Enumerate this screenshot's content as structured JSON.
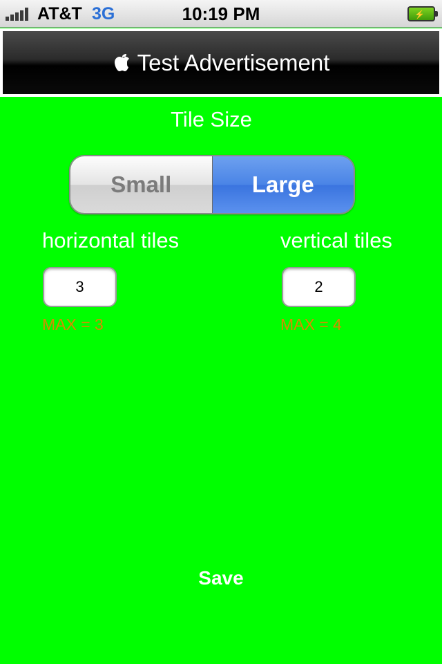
{
  "status_bar": {
    "carrier": "AT&T",
    "network": "3G",
    "time": "10:19 PM",
    "icons": [
      "signal-bars-icon",
      "battery-charging-icon"
    ]
  },
  "ad": {
    "text": "Test Advertisement",
    "icon": "apple-logo-icon"
  },
  "settings": {
    "title": "Tile Size",
    "segments": [
      "Small",
      "Large"
    ],
    "selected_segment": "Large",
    "horizontal": {
      "label": "horizontal tiles",
      "value": "3",
      "max": "MAX = 3"
    },
    "vertical": {
      "label": "vertical tiles",
      "value": "2",
      "max": "MAX = 4"
    },
    "save_label": "Save"
  },
  "colors": {
    "background": "#00ff00",
    "segment_selected": "#4a84e6",
    "max_text": "#d98a00"
  }
}
